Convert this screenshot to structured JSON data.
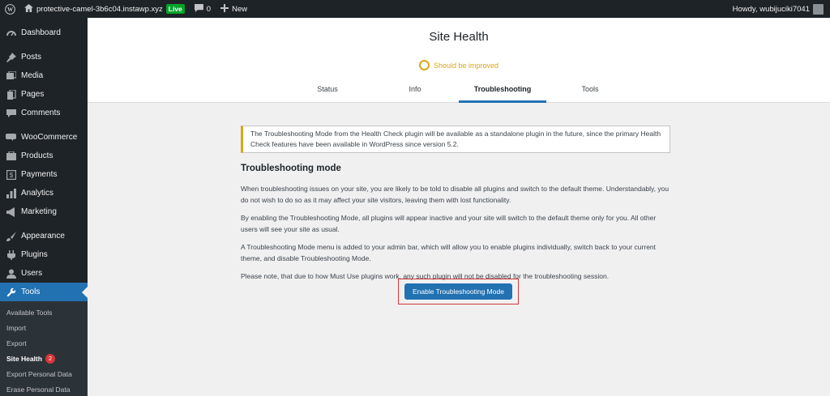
{
  "admin_bar": {
    "site_name": "protective-camel-3b6c04.instawp.xyz",
    "live_badge": "Live",
    "comments_count": "0",
    "new_label": "New",
    "greeting": "Howdy, wubijuciki7041"
  },
  "sidebar": {
    "items": [
      {
        "label": "Dashboard",
        "icon": "dashboard-icon"
      },
      {
        "label": "Posts",
        "icon": "pin-icon"
      },
      {
        "label": "Media",
        "icon": "media-icon"
      },
      {
        "label": "Pages",
        "icon": "pages-icon"
      },
      {
        "label": "Comments",
        "icon": "comments-icon"
      },
      {
        "label": "WooCommerce",
        "icon": "woocommerce-icon"
      },
      {
        "label": "Products",
        "icon": "products-icon"
      },
      {
        "label": "Payments",
        "icon": "payments-icon"
      },
      {
        "label": "Analytics",
        "icon": "analytics-icon"
      },
      {
        "label": "Marketing",
        "icon": "megaphone-icon"
      },
      {
        "label": "Appearance",
        "icon": "paintbrush-icon"
      },
      {
        "label": "Plugins",
        "icon": "plugin-icon"
      },
      {
        "label": "Users",
        "icon": "users-icon"
      },
      {
        "label": "Tools",
        "icon": "wrench-icon"
      }
    ],
    "submenu": [
      {
        "label": "Available Tools"
      },
      {
        "label": "Import"
      },
      {
        "label": "Export"
      },
      {
        "label": "Site Health",
        "badge": "2"
      },
      {
        "label": "Export Personal Data"
      },
      {
        "label": "Erase Personal Data"
      }
    ]
  },
  "header": {
    "title": "Site Health",
    "status": "Should be improved",
    "tabs": [
      {
        "label": "Status"
      },
      {
        "label": "Info"
      },
      {
        "label": "Troubleshooting"
      },
      {
        "label": "Tools"
      }
    ]
  },
  "main": {
    "notice": "The Troubleshooting Mode from the Health Check plugin will be available as a standalone plugin in the future, since the primary Health Check features have been available in WordPress since version 5.2.",
    "heading": "Troubleshooting mode",
    "paragraphs": [
      "When troubleshooting issues on your site, you are likely to be told to disable all plugins and switch to the default theme. Understandably, you do not wish to do so as it may affect your site visitors, leaving them with lost functionality.",
      "By enabling the Troubleshooting Mode, all plugins will appear inactive and your site will switch to the default theme only for you. All other users will see your site as usual.",
      "A Troubleshooting Mode menu is added to your admin bar, which will allow you to enable plugins individually, switch back to your current theme, and disable Troubleshooting Mode.",
      "Please note, that due to how Must Use plugins work, any such plugin will not be disabled for the troubleshooting session."
    ],
    "button_label": "Enable Troubleshooting Mode"
  },
  "colors": {
    "admin_dark": "#1d2327",
    "accent_blue": "#2271b1",
    "warning_yellow": "#dba617",
    "live_green": "#00a32a",
    "highlight_red": "#d63638"
  }
}
